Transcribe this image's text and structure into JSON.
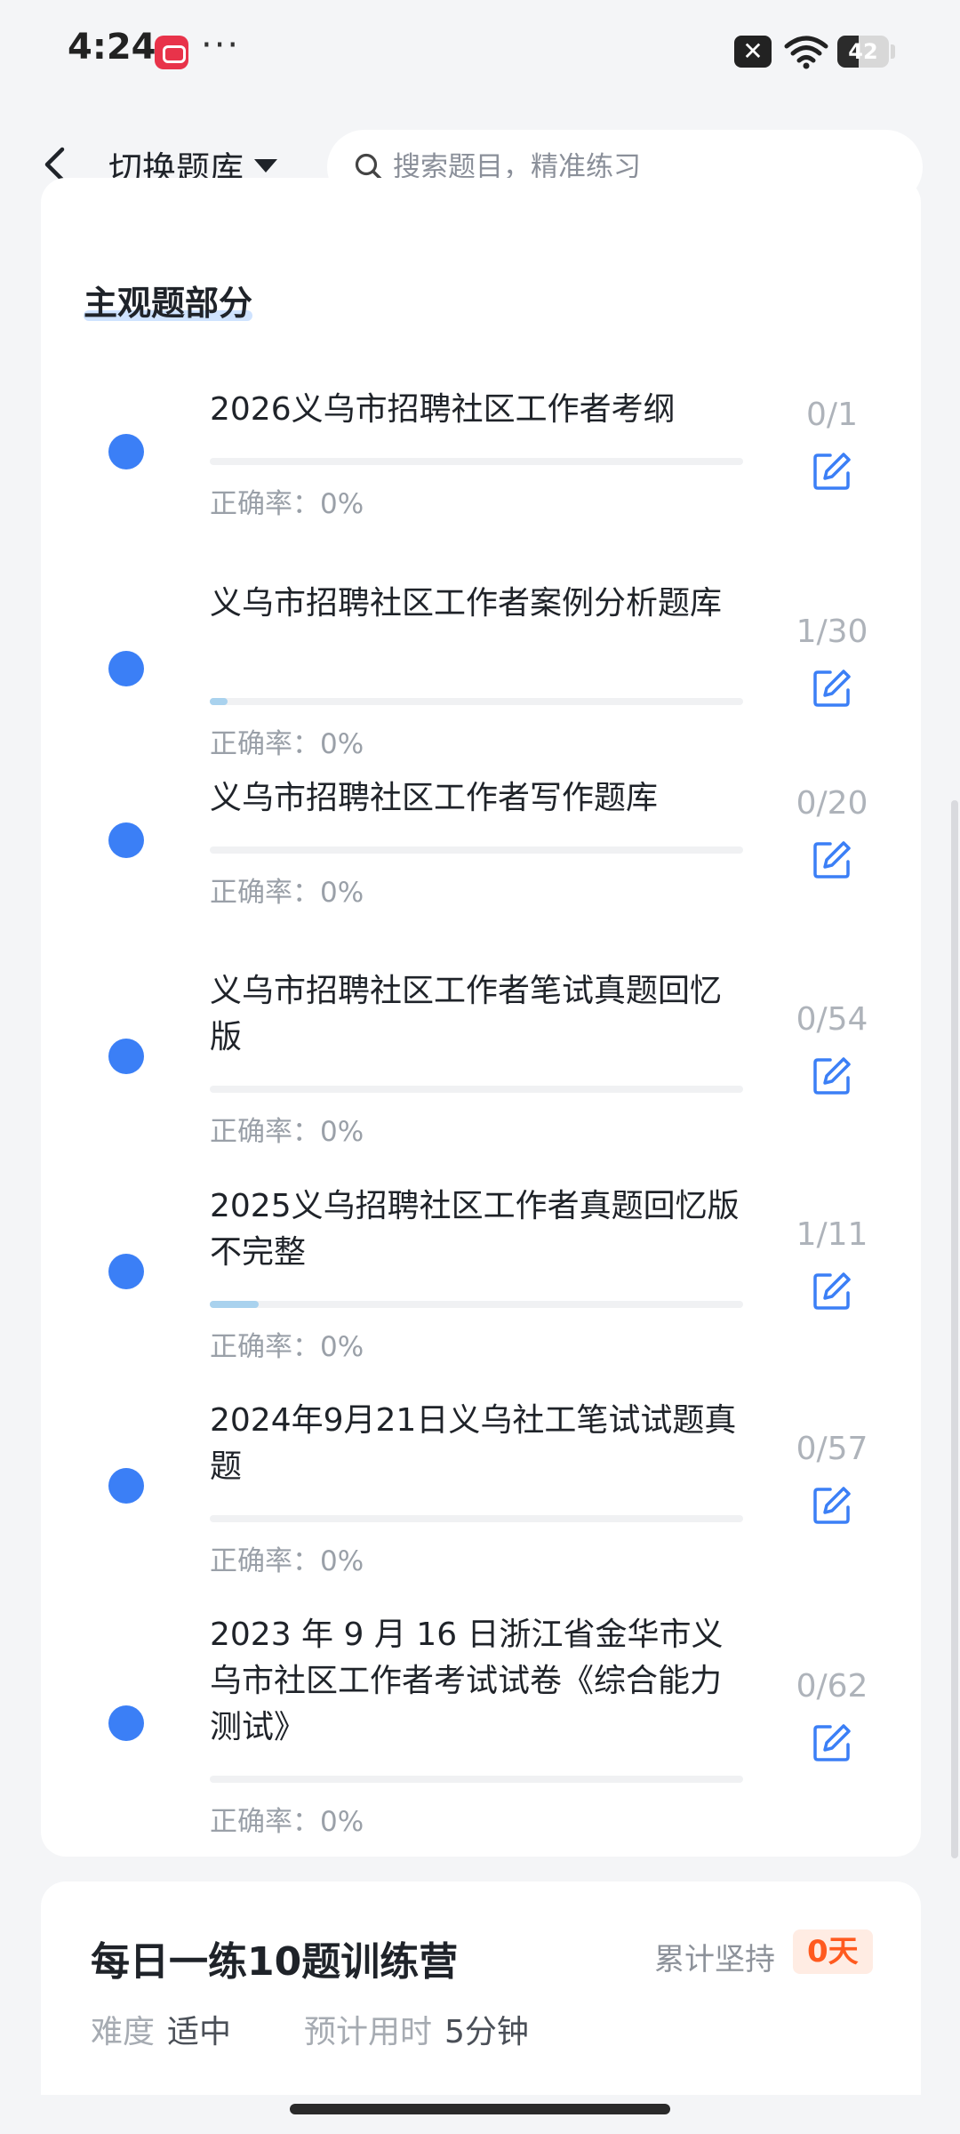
{
  "status_bar": {
    "time": "4:24",
    "more_dots": "···",
    "battery_level": 42,
    "battery_text": "42",
    "icons": [
      "app-notification-icon",
      "close-square-icon",
      "wifi-icon",
      "battery-icon"
    ]
  },
  "header": {
    "back_icon": "chevron-left-icon",
    "switch_label": "切换题库",
    "search_placeholder": "搜索题目，精准练习",
    "search_icon": "search-icon"
  },
  "section": {
    "title": "主观题部分",
    "accent_color": "#3b7ff6"
  },
  "items": [
    {
      "title": "2026义乌市招聘社区工作者考纲",
      "count": "0/1",
      "rate": "正确率：0%",
      "progress": 0.0
    },
    {
      "title": "义乌市招聘社区工作者案例分析题库",
      "count": "1/30",
      "rate": "正确率：0%",
      "progress": 0.033
    },
    {
      "title": "义乌市招聘社区工作者写作题库",
      "count": "0/20",
      "rate": "正确率：0%",
      "progress": 0.0
    },
    {
      "title": "义乌市招聘社区工作者笔试真题回忆版",
      "count": "0/54",
      "rate": "正确率：0%",
      "progress": 0.0
    },
    {
      "title": "2025义乌招聘社区工作者真题回忆版不完整",
      "count": "1/11",
      "rate": "正确率：0%",
      "progress": 0.091
    },
    {
      "title": "2024年9月21日义乌社工笔试试题真题",
      "count": "0/57",
      "rate": "正确率：0%",
      "progress": 0.0
    },
    {
      "title": "2023 年 9 月 16 日浙江省金华市义乌市社区工作者考试试卷《综合能力测试》",
      "count": "0/62",
      "rate": "正确率：0%",
      "progress": 0.0
    }
  ],
  "camp": {
    "title": "每日一练10题训练营",
    "streak_label": "累计坚持",
    "streak_value": "0天",
    "difficulty_label": "难度",
    "difficulty_value": "适中",
    "time_label": "预计用时",
    "time_value": "5分钟"
  }
}
